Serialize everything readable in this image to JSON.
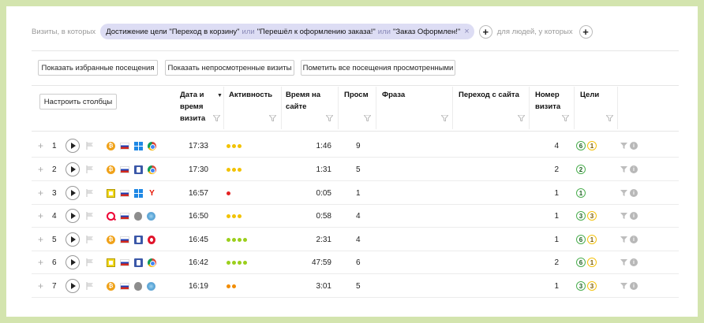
{
  "filter": {
    "prefix": "Визиты, в которых",
    "segment_part1": "Достижение цели \"Переход в корзину\"",
    "or1": "или",
    "segment_part2": "\"Перешёл к оформлению заказа!\"",
    "or2": "или",
    "segment_part3": "\"Заказ Оформлен!\"",
    "close_symbol": "×",
    "plus_symbol": "+",
    "people_label": "для людей, у которых"
  },
  "actions": {
    "show_favorites": "Показать избранные посещения",
    "show_unviewed": "Показать непросмотренные визиты",
    "mark_all_viewed": "Пометить все посещения просмотренными",
    "configure_columns": "Настроить столбцы"
  },
  "columns": {
    "date": "Дата и время визита",
    "activity": "Активность",
    "time_on_site": "Время на сайте",
    "views": "Просм",
    "phrase": "Фраза",
    "referrer": "Переход с сайта",
    "visit_number": "Номер визита",
    "goals": "Цели"
  },
  "colors": {
    "accent_chip": "#ddddf4",
    "background": "#d3e4ae"
  },
  "rows": [
    {
      "num": "1",
      "source_icon": "bitcoin-icon",
      "os_icon": "windows-icon",
      "browser_icon": "chrome-icon",
      "time": "17:33",
      "activity_count": 3,
      "activity_color": "#f2c200",
      "duration": "1:46",
      "views": "9",
      "visit_number": "4",
      "goals": [
        {
          "v": "6",
          "c": "green"
        },
        {
          "v": "1",
          "c": "yellow"
        }
      ]
    },
    {
      "num": "2",
      "source_icon": "bitcoin-icon",
      "os_icon": "mac-icon",
      "browser_icon": "chrome-icon",
      "time": "17:30",
      "activity_count": 3,
      "activity_color": "#f2c200",
      "duration": "1:31",
      "views": "5",
      "visit_number": "2",
      "goals": [
        {
          "v": "2",
          "c": "green"
        }
      ]
    },
    {
      "num": "3",
      "source_icon": "ad-icon",
      "os_icon": "windows-icon",
      "browser_icon": "yandex-icon",
      "time": "16:57",
      "activity_count": 1,
      "activity_color": "#e42222",
      "duration": "0:05",
      "views": "1",
      "visit_number": "1",
      "goals": [
        {
          "v": "1",
          "c": "green"
        }
      ]
    },
    {
      "num": "4",
      "source_icon": "search-icon",
      "os_icon": "apple-icon",
      "browser_icon": "safari-icon",
      "time": "16:50",
      "activity_count": 3,
      "activity_color": "#f2c200",
      "duration": "0:58",
      "views": "4",
      "visit_number": "1",
      "goals": [
        {
          "v": "3",
          "c": "green"
        },
        {
          "v": "3",
          "c": "yellow"
        }
      ]
    },
    {
      "num": "5",
      "source_icon": "bitcoin-icon",
      "os_icon": "mac-icon",
      "browser_icon": "opera-icon",
      "time": "16:45",
      "activity_count": 4,
      "activity_color": "#9bcf1c",
      "duration": "2:31",
      "views": "4",
      "visit_number": "1",
      "goals": [
        {
          "v": "6",
          "c": "green"
        },
        {
          "v": "1",
          "c": "yellow"
        }
      ]
    },
    {
      "num": "6",
      "source_icon": "ad-icon",
      "os_icon": "mac-icon",
      "browser_icon": "chrome-icon",
      "time": "16:42",
      "activity_count": 4,
      "activity_color": "#9bcf1c",
      "duration": "47:59",
      "views": "6",
      "visit_number": "2",
      "goals": [
        {
          "v": "6",
          "c": "green"
        },
        {
          "v": "1",
          "c": "yellow"
        }
      ]
    },
    {
      "num": "7",
      "source_icon": "bitcoin-icon",
      "os_icon": "apple-icon",
      "browser_icon": "safari-icon",
      "time": "16:19",
      "activity_count": 2,
      "activity_color": "#f28c00",
      "duration": "3:01",
      "views": "5",
      "visit_number": "1",
      "goals": [
        {
          "v": "3",
          "c": "green"
        },
        {
          "v": "3",
          "c": "yellow"
        }
      ]
    }
  ]
}
